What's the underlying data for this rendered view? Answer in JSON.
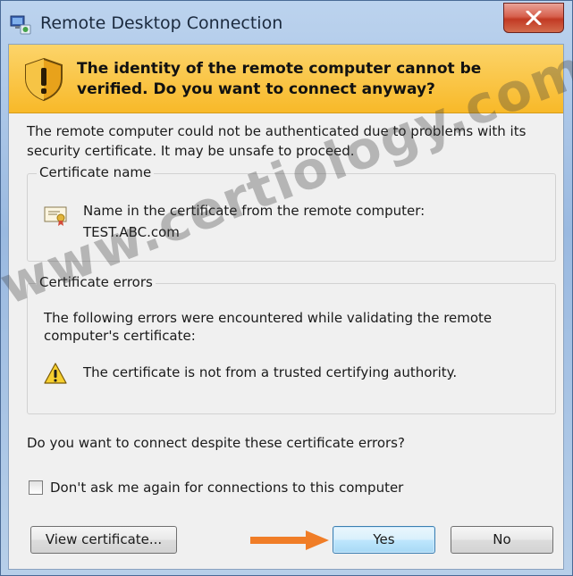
{
  "window": {
    "title": "Remote Desktop Connection"
  },
  "banner": {
    "heading": "The identity of the remote computer cannot be verified. Do you want to connect anyway?",
    "icon": "shield-warning-icon",
    "color": "#f8b929"
  },
  "intro": "The remote computer could not be authenticated due to problems with its security certificate. It may be unsafe to proceed.",
  "certificate_name": {
    "title": "Certificate name",
    "label": "Name in the certificate from the remote computer:",
    "value": "TEST.ABC.com"
  },
  "certificate_errors": {
    "title": "Certificate errors",
    "description": "The following errors were encountered while validating the remote computer's certificate:",
    "items": [
      "The certificate is not from a trusted certifying authority."
    ]
  },
  "question": "Do you want to connect despite these certificate errors?",
  "dont_ask": {
    "label": "Don't ask me again for connections to this computer",
    "checked": false
  },
  "buttons": {
    "view_certificate": "View certificate...",
    "yes": "Yes",
    "no": "No"
  },
  "watermark": "www.certiology.com",
  "accent_colors": {
    "arrow": "#f07d27",
    "close": "#c23a24"
  }
}
